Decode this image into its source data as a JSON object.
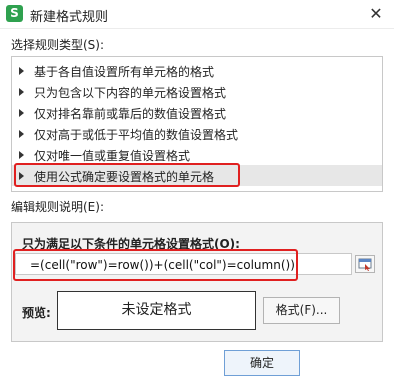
{
  "window": {
    "app_icon_glyph": "S",
    "title": "新建格式规则",
    "close_glyph": "✕"
  },
  "rule_type": {
    "section_label": "选择规则类型(S):",
    "items": [
      {
        "label": "基于各自值设置所有单元格的格式",
        "selected": false
      },
      {
        "label": "只为包含以下内容的单元格设置格式",
        "selected": false
      },
      {
        "label": "仅对排名靠前或靠后的数值设置格式",
        "selected": false
      },
      {
        "label": "仅对高于或低于平均值的数值设置格式",
        "selected": false
      },
      {
        "label": "仅对唯一值或重复值设置格式",
        "selected": false
      },
      {
        "label": "使用公式确定要设置格式的单元格",
        "selected": true
      }
    ]
  },
  "edit": {
    "section_label": "编辑规则说明(E):",
    "condition_label": "只为满足以下条件的单元格设置格式(O):",
    "formula_value": "=(cell(\"row\")=row())+(cell(\"col\")=column())",
    "preview_label": "预览:",
    "preview_text": "未设定格式",
    "format_button": "格式(F)..."
  },
  "footer": {
    "ok_button": "确定"
  },
  "colors": {
    "highlight_border": "#e02020",
    "selected_row": "#e7e7e7",
    "app_icon": "#2fa14f"
  }
}
